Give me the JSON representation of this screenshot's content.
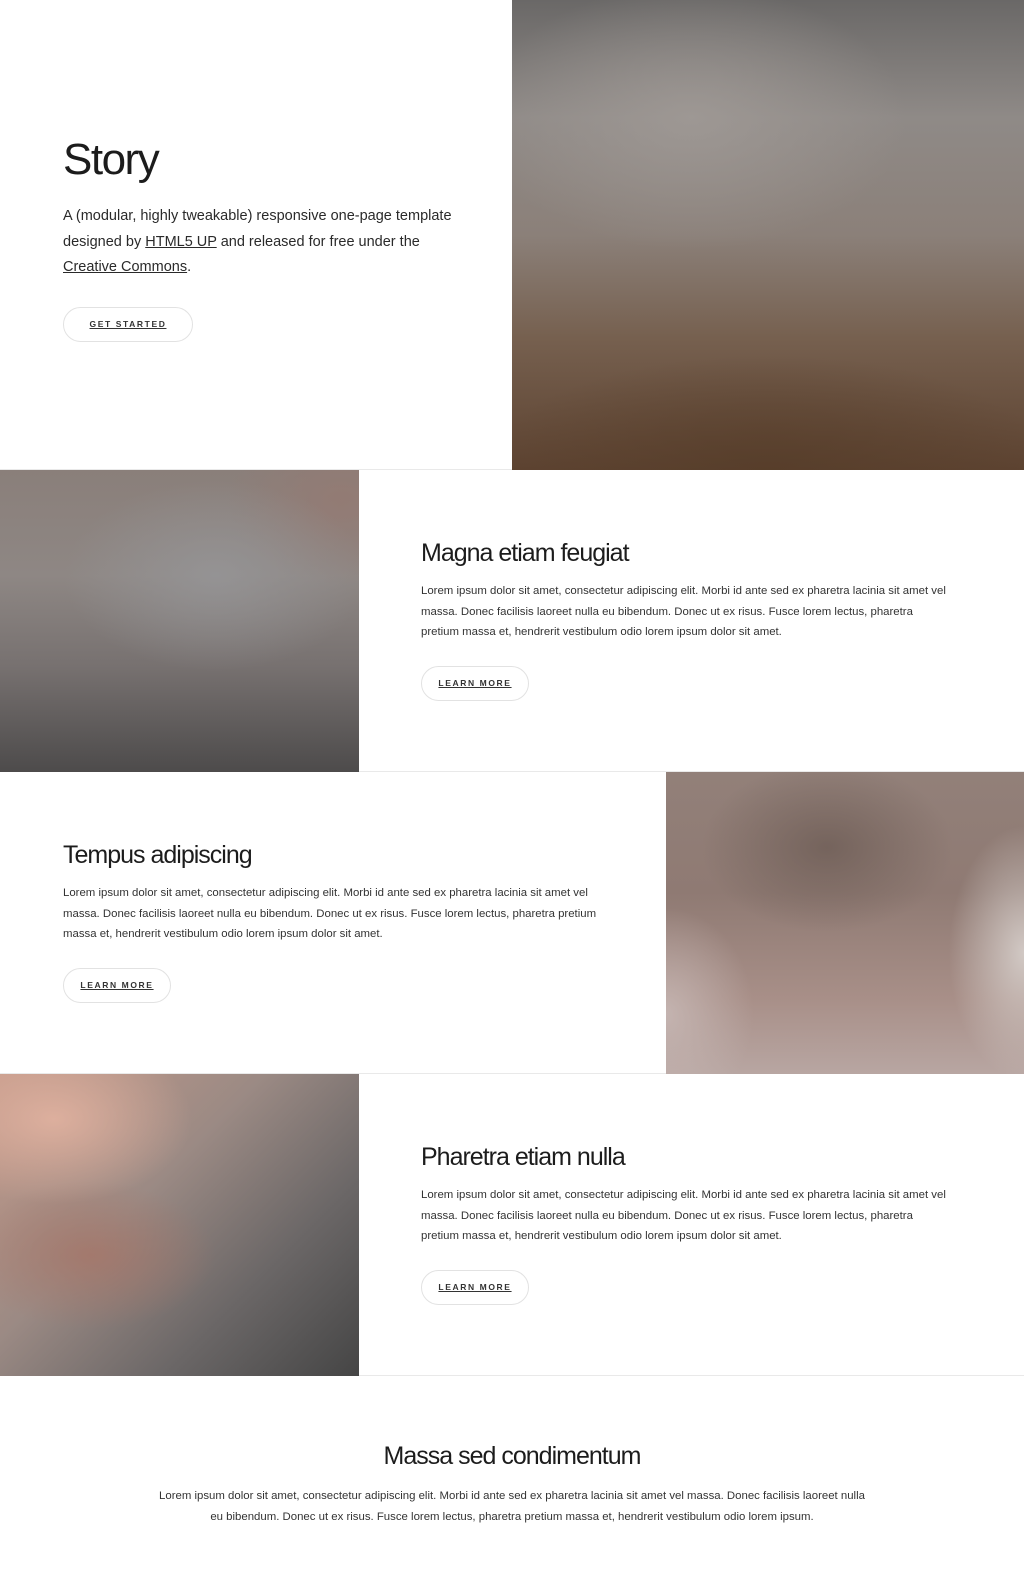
{
  "banner": {
    "title": "Story",
    "text_before_link1": "A (modular, highly tweakable) responsive one-page template designed by ",
    "link1": "HTML5 UP",
    "text_between": " and released for free under the ",
    "link2": "Creative Commons",
    "text_after": ".",
    "button": "GET STARTED"
  },
  "spotlights": [
    {
      "title": "Magna etiam feugiat",
      "text": "Lorem ipsum dolor sit amet, consectetur adipiscing elit. Morbi id ante sed ex pharetra lacinia sit amet vel massa. Donec facilisis laoreet nulla eu bibendum. Donec ut ex risus. Fusce lorem lectus, pharetra pretium massa et, hendrerit vestibulum odio lorem ipsum dolor sit amet.",
      "button": "LEARN MORE"
    },
    {
      "title": "Tempus adipiscing",
      "text": "Lorem ipsum dolor sit amet, consectetur adipiscing elit. Morbi id ante sed ex pharetra lacinia sit amet vel massa. Donec facilisis laoreet nulla eu bibendum. Donec ut ex risus. Fusce lorem lectus, pharetra pretium massa et, hendrerit vestibulum odio lorem ipsum dolor sit amet.",
      "button": "LEARN MORE"
    },
    {
      "title": "Pharetra etiam nulla",
      "text": "Lorem ipsum dolor sit amet, consectetur adipiscing elit. Morbi id ante sed ex pharetra lacinia sit amet vel massa. Donec facilisis laoreet nulla eu bibendum. Donec ut ex risus. Fusce lorem lectus, pharetra pretium massa et, hendrerit vestibulum odio lorem ipsum dolor sit amet.",
      "button": "LEARN MORE"
    }
  ],
  "final": {
    "title": "Massa sed condimentum",
    "text": "Lorem ipsum dolor sit amet, consectetur adipiscing elit. Morbi id ante sed ex pharetra lacinia sit amet vel massa. Donec facilisis laoreet nulla eu bibendum. Donec ut ex risus. Fusce lorem lectus, pharetra pretium massa et, hendrerit vestibulum odio lorem ipsum."
  }
}
